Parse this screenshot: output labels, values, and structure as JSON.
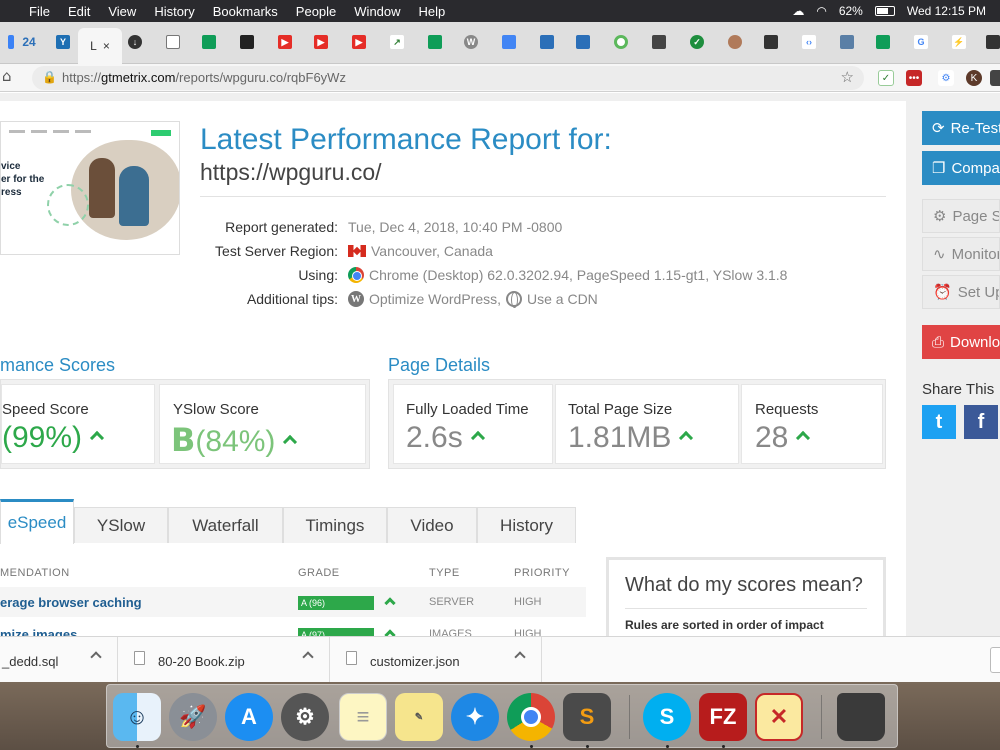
{
  "menubar": {
    "app_menus": [
      "File",
      "Edit",
      "View",
      "History",
      "Bookmarks",
      "People",
      "Window",
      "Help"
    ],
    "battery": "62%",
    "clock": "Wed 12:15 PM"
  },
  "tabs": {
    "count_badge": "24",
    "active_label": "L",
    "close_glyph": "×"
  },
  "address": {
    "scheme": "https://",
    "host": "gtmetrix.com",
    "path": "/reports/wpguru.co/rqbF6yWz"
  },
  "extensions": {
    "profile_initial": "K"
  },
  "thumbnail": {
    "hero_lines": [
      "vice",
      "er for the",
      "ress"
    ]
  },
  "report": {
    "title": "Latest Performance Report for:",
    "url": "https://wpguru.co/",
    "rows": [
      {
        "label": "Report generated:",
        "value": "Tue, Dec 4, 2018, 10:40 PM -0800"
      },
      {
        "label": "Test Server Region:",
        "value": "Vancouver, Canada"
      },
      {
        "label": "Using:",
        "value": "Chrome (Desktop) 62.0.3202.94, PageSpeed 1.15-gt1, YSlow 3.1.8"
      },
      {
        "label": "Additional tips:",
        "value": "Optimize WordPress,",
        "value2": "Use a CDN"
      }
    ]
  },
  "scores": {
    "heading": "mance Scores",
    "pagespeed_label": "Speed Score",
    "pagespeed_value": "(99%)",
    "yslow_label": "YSlow Score",
    "yslow_grade": "B",
    "yslow_value": "(84%)"
  },
  "details": {
    "heading": "Page Details",
    "items": [
      {
        "label": "Fully Loaded Time",
        "value": "2.6s"
      },
      {
        "label": "Total Page Size",
        "value": "1.81MB"
      },
      {
        "label": "Requests",
        "value": "28"
      }
    ]
  },
  "page_tabs": [
    "eSpeed",
    "YSlow",
    "Waterfall",
    "Timings",
    "Video",
    "History"
  ],
  "recommendations": {
    "headers": {
      "name": "MENDATION",
      "grade": "GRADE",
      "type": "TYPE",
      "priority": "PRIORITY"
    },
    "rows": [
      {
        "name": "erage browser caching",
        "grade": "A (96)",
        "grade_pct": 96,
        "type": "SERVER",
        "priority": "HIGH"
      },
      {
        "name": "mize images",
        "grade": "A (97)",
        "grade_pct": 97,
        "type": "IMAGES",
        "priority": "HIGH"
      }
    ]
  },
  "scores_mean": {
    "heading": "What do my scores mean?",
    "text": "Rules are sorted in order of impact"
  },
  "sidebar": {
    "retest": "Re-Test",
    "compare": "Compare",
    "page_settings": "Page Settings",
    "monitor": "Monitor",
    "setup": "Set Up",
    "download": "Download",
    "share_label": "Share This",
    "twitter": "t",
    "facebook": "f"
  },
  "downloads": [
    "_dedd.sql",
    "80-20 Book.zip",
    "customizer.json"
  ],
  "colors": {
    "accent": "#2b8cc4",
    "grade_green": "#2da84a",
    "download_red": "#e04444"
  }
}
